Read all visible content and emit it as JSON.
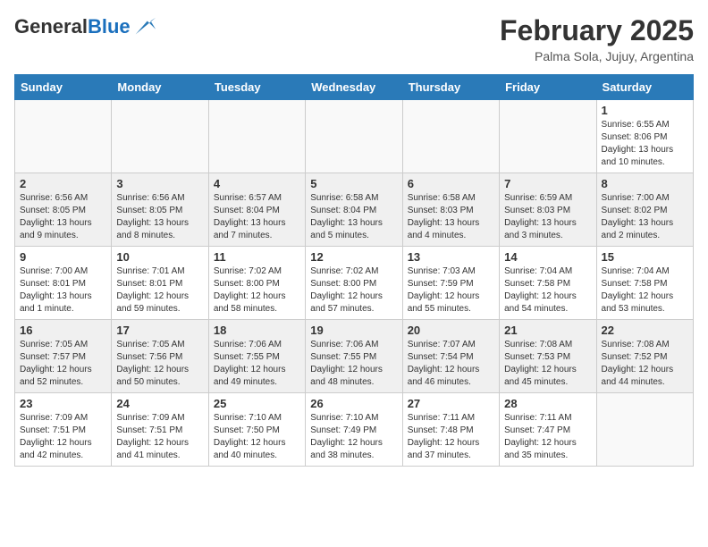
{
  "header": {
    "logo_general": "General",
    "logo_blue": "Blue",
    "month_title": "February 2025",
    "location": "Palma Sola, Jujuy, Argentina"
  },
  "weekdays": [
    "Sunday",
    "Monday",
    "Tuesday",
    "Wednesday",
    "Thursday",
    "Friday",
    "Saturday"
  ],
  "weeks": [
    {
      "shade": "white",
      "days": [
        {
          "num": "",
          "info": ""
        },
        {
          "num": "",
          "info": ""
        },
        {
          "num": "",
          "info": ""
        },
        {
          "num": "",
          "info": ""
        },
        {
          "num": "",
          "info": ""
        },
        {
          "num": "",
          "info": ""
        },
        {
          "num": "1",
          "info": "Sunrise: 6:55 AM\nSunset: 8:06 PM\nDaylight: 13 hours\nand 10 minutes."
        }
      ]
    },
    {
      "shade": "shaded",
      "days": [
        {
          "num": "2",
          "info": "Sunrise: 6:56 AM\nSunset: 8:05 PM\nDaylight: 13 hours\nand 9 minutes."
        },
        {
          "num": "3",
          "info": "Sunrise: 6:56 AM\nSunset: 8:05 PM\nDaylight: 13 hours\nand 8 minutes."
        },
        {
          "num": "4",
          "info": "Sunrise: 6:57 AM\nSunset: 8:04 PM\nDaylight: 13 hours\nand 7 minutes."
        },
        {
          "num": "5",
          "info": "Sunrise: 6:58 AM\nSunset: 8:04 PM\nDaylight: 13 hours\nand 5 minutes."
        },
        {
          "num": "6",
          "info": "Sunrise: 6:58 AM\nSunset: 8:03 PM\nDaylight: 13 hours\nand 4 minutes."
        },
        {
          "num": "7",
          "info": "Sunrise: 6:59 AM\nSunset: 8:03 PM\nDaylight: 13 hours\nand 3 minutes."
        },
        {
          "num": "8",
          "info": "Sunrise: 7:00 AM\nSunset: 8:02 PM\nDaylight: 13 hours\nand 2 minutes."
        }
      ]
    },
    {
      "shade": "white",
      "days": [
        {
          "num": "9",
          "info": "Sunrise: 7:00 AM\nSunset: 8:01 PM\nDaylight: 13 hours\nand 1 minute."
        },
        {
          "num": "10",
          "info": "Sunrise: 7:01 AM\nSunset: 8:01 PM\nDaylight: 12 hours\nand 59 minutes."
        },
        {
          "num": "11",
          "info": "Sunrise: 7:02 AM\nSunset: 8:00 PM\nDaylight: 12 hours\nand 58 minutes."
        },
        {
          "num": "12",
          "info": "Sunrise: 7:02 AM\nSunset: 8:00 PM\nDaylight: 12 hours\nand 57 minutes."
        },
        {
          "num": "13",
          "info": "Sunrise: 7:03 AM\nSunset: 7:59 PM\nDaylight: 12 hours\nand 55 minutes."
        },
        {
          "num": "14",
          "info": "Sunrise: 7:04 AM\nSunset: 7:58 PM\nDaylight: 12 hours\nand 54 minutes."
        },
        {
          "num": "15",
          "info": "Sunrise: 7:04 AM\nSunset: 7:58 PM\nDaylight: 12 hours\nand 53 minutes."
        }
      ]
    },
    {
      "shade": "shaded",
      "days": [
        {
          "num": "16",
          "info": "Sunrise: 7:05 AM\nSunset: 7:57 PM\nDaylight: 12 hours\nand 52 minutes."
        },
        {
          "num": "17",
          "info": "Sunrise: 7:05 AM\nSunset: 7:56 PM\nDaylight: 12 hours\nand 50 minutes."
        },
        {
          "num": "18",
          "info": "Sunrise: 7:06 AM\nSunset: 7:55 PM\nDaylight: 12 hours\nand 49 minutes."
        },
        {
          "num": "19",
          "info": "Sunrise: 7:06 AM\nSunset: 7:55 PM\nDaylight: 12 hours\nand 48 minutes."
        },
        {
          "num": "20",
          "info": "Sunrise: 7:07 AM\nSunset: 7:54 PM\nDaylight: 12 hours\nand 46 minutes."
        },
        {
          "num": "21",
          "info": "Sunrise: 7:08 AM\nSunset: 7:53 PM\nDaylight: 12 hours\nand 45 minutes."
        },
        {
          "num": "22",
          "info": "Sunrise: 7:08 AM\nSunset: 7:52 PM\nDaylight: 12 hours\nand 44 minutes."
        }
      ]
    },
    {
      "shade": "white",
      "days": [
        {
          "num": "23",
          "info": "Sunrise: 7:09 AM\nSunset: 7:51 PM\nDaylight: 12 hours\nand 42 minutes."
        },
        {
          "num": "24",
          "info": "Sunrise: 7:09 AM\nSunset: 7:51 PM\nDaylight: 12 hours\nand 41 minutes."
        },
        {
          "num": "25",
          "info": "Sunrise: 7:10 AM\nSunset: 7:50 PM\nDaylight: 12 hours\nand 40 minutes."
        },
        {
          "num": "26",
          "info": "Sunrise: 7:10 AM\nSunset: 7:49 PM\nDaylight: 12 hours\nand 38 minutes."
        },
        {
          "num": "27",
          "info": "Sunrise: 7:11 AM\nSunset: 7:48 PM\nDaylight: 12 hours\nand 37 minutes."
        },
        {
          "num": "28",
          "info": "Sunrise: 7:11 AM\nSunset: 7:47 PM\nDaylight: 12 hours\nand 35 minutes."
        },
        {
          "num": "",
          "info": ""
        }
      ]
    }
  ]
}
